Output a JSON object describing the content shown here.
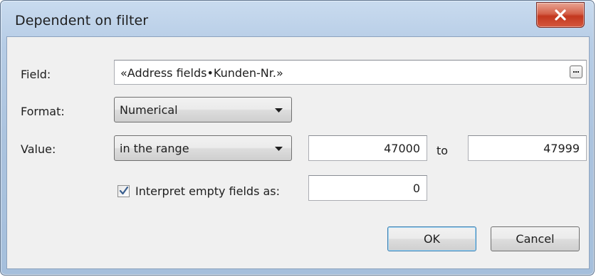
{
  "window": {
    "title": "Dependent on filter"
  },
  "icons": {
    "close": "close-icon",
    "ellipsis": "ellipsis-icon",
    "dropdown": "chevron-down-icon",
    "check": "checkmark-icon"
  },
  "field": {
    "label": "Field:",
    "value": "«Address fields•Kunden-Nr.»"
  },
  "format": {
    "label": "Format:",
    "selected": "Numerical"
  },
  "value_row": {
    "label": "Value:",
    "selected": "in the range",
    "from": "47000",
    "to_label": "to",
    "to": "47999"
  },
  "empty_fields": {
    "checked": true,
    "label": "Interpret empty fields as:",
    "value": "0"
  },
  "buttons": {
    "ok": "OK",
    "cancel": "Cancel"
  },
  "colors": {
    "frame": "#b7cde6",
    "close_button": "#c3371f",
    "client_background": "#f0f0f0"
  }
}
